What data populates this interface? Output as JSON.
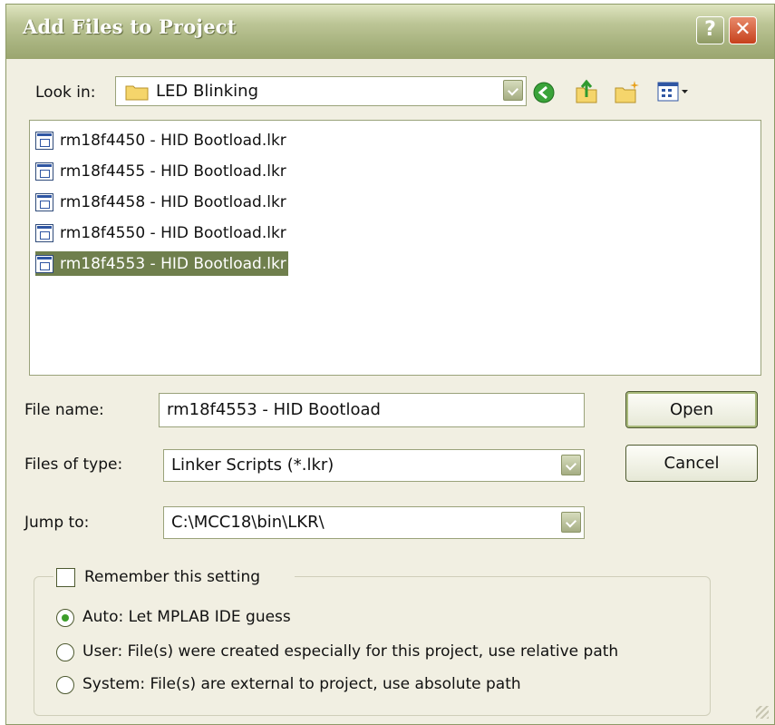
{
  "window": {
    "title": "Add Files to Project",
    "help_label": "?",
    "close_label": "✕"
  },
  "look_in": {
    "label": "Look in:",
    "value": "LED Blinking"
  },
  "toolbar": {
    "icons": [
      "back-icon",
      "up-folder-icon",
      "new-folder-icon",
      "views-icon"
    ]
  },
  "files": [
    "rm18f4450 - HID Bootload.lkr",
    "rm18f4455 - HID Bootload.lkr",
    "rm18f4458 - HID Bootload.lkr",
    "rm18f4550 - HID Bootload.lkr",
    "rm18f4553 - HID Bootload.lkr"
  ],
  "selected_file_index": 4,
  "file_name": {
    "label": "File name:",
    "value": "rm18f4553 - HID Bootload"
  },
  "files_of_type": {
    "label": "Files of type:",
    "value": "Linker Scripts (*.lkr)"
  },
  "jump_to": {
    "label": "Jump to:",
    "value": "C:\\MCC18\\bin\\LKR\\"
  },
  "buttons": {
    "open": "Open",
    "cancel": "Cancel"
  },
  "remember": {
    "label": "Remember this setting",
    "checked": false
  },
  "options": [
    {
      "label": "Auto: Let MPLAB IDE guess",
      "selected": true
    },
    {
      "label": "User: File(s) were created especially for this project, use relative path",
      "selected": false
    },
    {
      "label": "System: File(s) are external to project, use absolute path",
      "selected": false
    }
  ]
}
